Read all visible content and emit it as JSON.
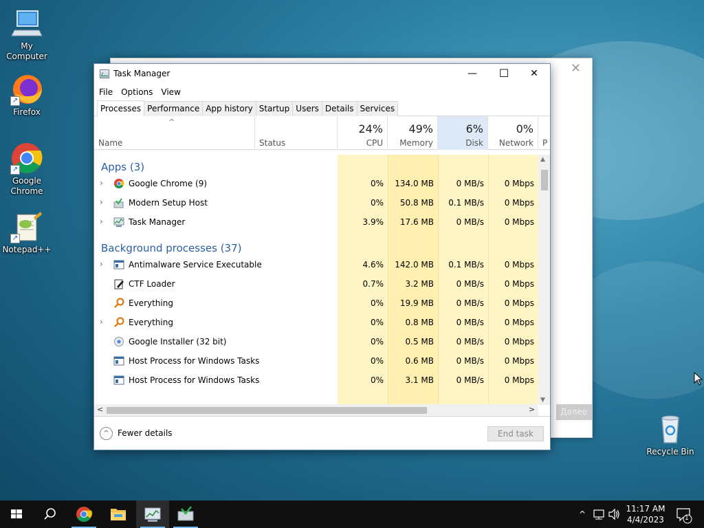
{
  "desktop": {
    "icons": [
      {
        "label": "My Computer",
        "icon": "computer-icon"
      },
      {
        "label": "Firefox",
        "icon": "firefox-icon"
      },
      {
        "label": "Google Chrome",
        "icon": "chrome-icon"
      },
      {
        "label": "Notepad++",
        "icon": "notepadpp-icon"
      },
      {
        "label": "Recycle Bin",
        "icon": "recycle-bin-icon"
      }
    ],
    "background_window": {
      "close": "✕",
      "button_label": "Далее"
    }
  },
  "task_manager": {
    "title": "Task Manager",
    "caption_buttons": {
      "minimize": "—",
      "maximize": "☐",
      "close": "✕"
    },
    "menu": [
      "File",
      "Options",
      "View"
    ],
    "tabs": [
      "Processes",
      "Performance",
      "App history",
      "Startup",
      "Users",
      "Details",
      "Services"
    ],
    "active_tab": "Processes",
    "columns": {
      "name": "Name",
      "status": "Status",
      "cpu": {
        "percent": "24%",
        "label": "CPU"
      },
      "memory": {
        "percent": "49%",
        "label": "Memory"
      },
      "disk": {
        "percent": "6%",
        "label": "Disk"
      },
      "network": {
        "percent": "0%",
        "label": "Network"
      },
      "power": "P"
    },
    "groups": {
      "apps": "Apps (3)",
      "background": "Background processes (37)"
    },
    "apps": [
      {
        "name": "Google Chrome (9)",
        "icon": "chrome-icon",
        "expandable": true,
        "cpu": "0%",
        "memory": "134.0 MB",
        "disk": "0 MB/s",
        "network": "0 Mbps"
      },
      {
        "name": "Modern Setup Host",
        "icon": "setup-host-icon",
        "expandable": true,
        "cpu": "0%",
        "memory": "50.8 MB",
        "disk": "0.1 MB/s",
        "network": "0 Mbps"
      },
      {
        "name": "Task Manager",
        "icon": "task-manager-icon",
        "expandable": true,
        "cpu": "3.9%",
        "memory": "17.6 MB",
        "disk": "0 MB/s",
        "network": "0 Mbps"
      }
    ],
    "background": [
      {
        "name": "Antimalware Service Executable",
        "icon": "service-window-icon",
        "expandable": true,
        "cpu": "4.6%",
        "memory": "142.0 MB",
        "disk": "0.1 MB/s",
        "network": "0 Mbps"
      },
      {
        "name": "CTF Loader",
        "icon": "ctf-loader-icon",
        "expandable": false,
        "cpu": "0.7%",
        "memory": "3.2 MB",
        "disk": "0 MB/s",
        "network": "0 Mbps"
      },
      {
        "name": "Everything",
        "icon": "everything-search-icon",
        "expandable": false,
        "cpu": "0%",
        "memory": "19.9 MB",
        "disk": "0 MB/s",
        "network": "0 Mbps"
      },
      {
        "name": "Everything",
        "icon": "everything-search-icon",
        "expandable": true,
        "cpu": "0%",
        "memory": "0.8 MB",
        "disk": "0 MB/s",
        "network": "0 Mbps"
      },
      {
        "name": "Google Installer (32 bit)",
        "icon": "installer-icon",
        "expandable": false,
        "cpu": "0%",
        "memory": "0.5 MB",
        "disk": "0 MB/s",
        "network": "0 Mbps"
      },
      {
        "name": "Host Process for Windows Tasks",
        "icon": "service-window-icon",
        "expandable": false,
        "cpu": "0%",
        "memory": "0.6 MB",
        "disk": "0 MB/s",
        "network": "0 Mbps"
      },
      {
        "name": "Host Process for Windows Tasks",
        "icon": "service-window-icon",
        "expandable": false,
        "cpu": "0%",
        "memory": "3.1 MB",
        "disk": "0 MB/s",
        "network": "0 Mbps"
      }
    ],
    "footer": {
      "fewer_details": "Fewer details",
      "end_task": "End task"
    }
  },
  "taskbar": {
    "items": [
      "start-icon",
      "search-icon",
      "chrome-icon",
      "file-explorer-icon",
      "task-manager-icon",
      "setup-host-icon"
    ],
    "tray": {
      "time": "11:17 AM",
      "date": "4/4/2023",
      "notification_count": "1"
    }
  },
  "colors": {
    "cpu_col": "#fff4c4",
    "mem_col": "#ffefb0",
    "disk_header": "#dde9f7",
    "group_text": "#2a5fa3",
    "taskbar": "#101010"
  }
}
